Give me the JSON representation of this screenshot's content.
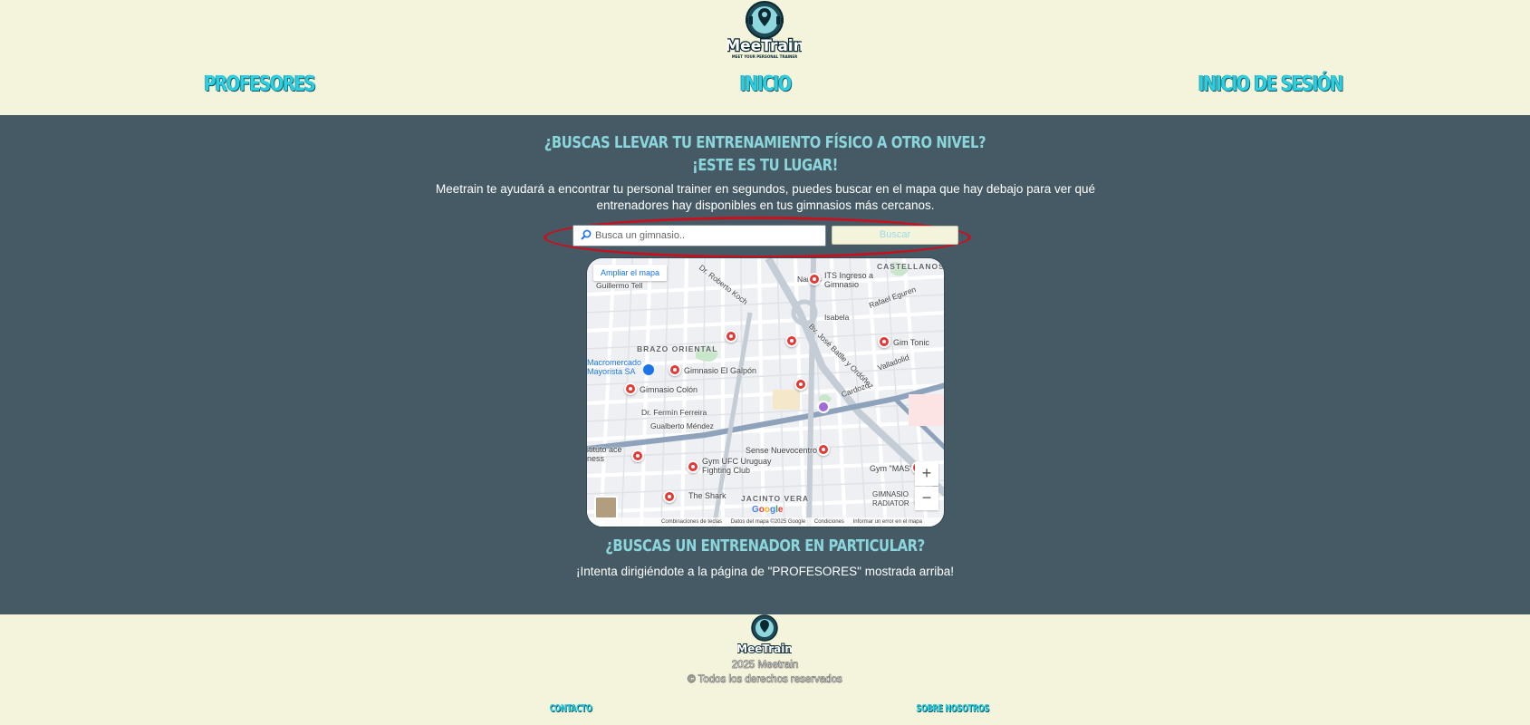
{
  "header": {
    "logo_text": "MeeTrain",
    "logo_tagline": "MEET YOUR PERSONAL TRAINER",
    "nav": {
      "profesores": "PROFESORES",
      "inicio": "INICIO",
      "login": "INICIO DE SESIÓN"
    }
  },
  "hero": {
    "title_line1": "¿BUSCAS LLEVAR TU ENTRENAMIENTO FÍSICO A OTRO NIVEL?",
    "title_line2": "¡ESTE ES TU LUGAR!",
    "description": "Meetrain te ayudará a encontrar tu personal trainer en segundos, puedes buscar en el mapa que hay debajo para ver qué entrenadores hay disponibles en tus gimnasios más cercanos."
  },
  "search": {
    "placeholder": "Busca un gimnasio..",
    "button_label": "Buscar"
  },
  "map": {
    "expand_label": "Ampliar el mapa",
    "zoom_in": "+",
    "zoom_out": "−",
    "google_text": "Google",
    "attribution": {
      "shortcuts": "Combinaciones de teclas",
      "data": "Datos del mapa ©2025 Google",
      "terms": "Condiciones",
      "report": "Informar un error en el mapa"
    },
    "districts": {
      "castellanos": "CASTELLANOS",
      "brazo_oriental": "BRAZO ORIENTAL",
      "jacinto_vera": "JACINTO VERA"
    },
    "places": {
      "its": "ITS Ingreso a Gimnasio",
      "gim_tonic": "Gim Tonic",
      "el_galpon": "Gimnasio El Galpón",
      "colon": "Gimnasio Colón",
      "macromercado": "Macromercado Mayorista SA",
      "sense": "Sense Nuevocentro",
      "instituto": "Instituto ace Fitness",
      "ufc": "Gym UFC Uruguay Fighting Club",
      "gym_mas": "Gym \"MAS\"",
      "the_shark": "The Shark",
      "gimnasio_radiator": "GIMNASIO RADIATOR"
    },
    "streets": {
      "roberto_koch": "Dr. Roberto Koch",
      "battle": "Bv. José Batlle y Ordóñez",
      "fermin": "Dr. Fermín Ferreira",
      "gualberto": "Gualberto Méndez",
      "guillermo_tell": "Guillermo Tell",
      "nantes": "Nantes",
      "isabela": "Isabela",
      "rafael": "Rafael Eguren",
      "valladolid": "Valladolid",
      "cardozo": "Cardozo"
    }
  },
  "secondary": {
    "title": "¿BUSCAS UN ENTRENADOR EN PARTICULAR?",
    "description": "¡Intenta dirigiéndote a la página de \"PROFESORES\" mostrada arriba!"
  },
  "footer": {
    "logo_text": "MeeTrain",
    "year_line": "2025 Meetrain",
    "rights": "© Todos los derechos reservados",
    "contact": "CONTACTO",
    "about": "SOBRE NOSOTROS"
  },
  "colors": {
    "cream": "#f4f3dc",
    "slate": "#455a64",
    "accent": "#2ccfe0",
    "title": "#8bd6dc",
    "highlight_ring": "#c8101e",
    "pin": "#e53935"
  }
}
